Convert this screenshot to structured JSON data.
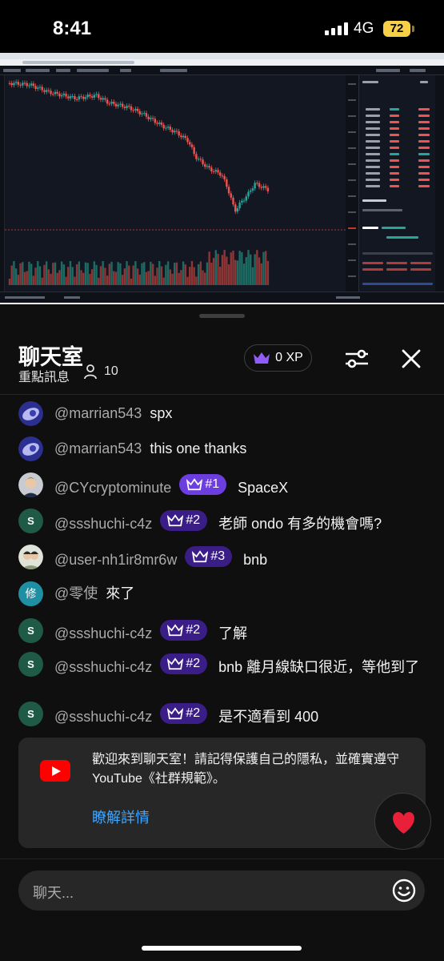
{
  "status": {
    "time": "8:41",
    "network": "4G",
    "battery": "72"
  },
  "chat": {
    "title": "聊天室",
    "subtitle": "重點訊息",
    "viewers": "10",
    "xp": "0 XP",
    "messages": [
      {
        "author": "@marrian543",
        "text": "spx",
        "badge": "",
        "avatar": "img"
      },
      {
        "author": "@marrian543",
        "text": "this one thanks",
        "badge": "",
        "avatar": "img"
      },
      {
        "author": "@CYcryptominute",
        "text": "SpaceX",
        "badge": "#1",
        "avatar": "img"
      },
      {
        "author": "@ssshuchi-c4z",
        "text": "老師 ondo 有多的機會嗎?",
        "badge": "#2",
        "avatar": "S"
      },
      {
        "author": "@user-nh1ir8mr6w",
        "text": "bnb",
        "badge": "#3",
        "avatar": "img"
      },
      {
        "author": "@零使",
        "text": "來了",
        "badge": "",
        "avatar": "修"
      },
      {
        "author": "@ssshuchi-c4z",
        "text": "了解",
        "badge": "#2",
        "avatar": "S"
      },
      {
        "author": "@ssshuchi-c4z",
        "text": "bnb 離月線缺口很近，等他到了",
        "badge": "#2",
        "avatar": "S"
      },
      {
        "author": "@ssshuchi-c4z",
        "text": "是不適看到 400",
        "badge": "#2",
        "avatar": "S"
      }
    ],
    "notice": {
      "text": "歡迎來到聊天室！請記得保護自己的隱私，並確實遵守 YouTube《社群規範》。",
      "link": "瞭解詳情"
    },
    "input_placeholder": "聊天..."
  },
  "colors": {
    "link": "#3ea6ff",
    "badge": "#3a1d86",
    "badge_top": "#6c3ee0",
    "youtube_red": "#ff0000",
    "heart": "#e8203a"
  }
}
